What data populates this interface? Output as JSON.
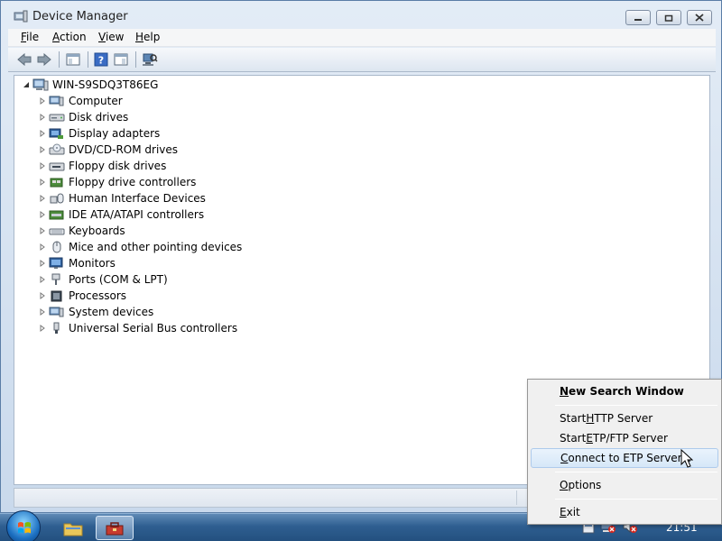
{
  "window": {
    "title": "Device Manager"
  },
  "menubar": {
    "items": [
      {
        "accel": "F",
        "rest": "ile"
      },
      {
        "accel": "A",
        "rest": "ction"
      },
      {
        "accel": "V",
        "rest": "iew"
      },
      {
        "accel": "H",
        "rest": "elp"
      }
    ]
  },
  "toolbar": {
    "buttons": [
      "back-icon",
      "forward-icon",
      "show-hide-console-tree-icon",
      "help-icon",
      "action-pane-icon",
      "scan-hardware-icon"
    ]
  },
  "tree": {
    "root": "WIN-S9SDQ3T86EG",
    "categories": [
      {
        "label": "Computer",
        "icon": "computer-icon"
      },
      {
        "label": "Disk drives",
        "icon": "disk-drive-icon"
      },
      {
        "label": "Display adapters",
        "icon": "display-adapter-icon"
      },
      {
        "label": "DVD/CD-ROM drives",
        "icon": "dvd-drive-icon"
      },
      {
        "label": "Floppy disk drives",
        "icon": "floppy-disk-icon"
      },
      {
        "label": "Floppy drive controllers",
        "icon": "floppy-controller-icon"
      },
      {
        "label": "Human Interface Devices",
        "icon": "hid-icon"
      },
      {
        "label": "IDE ATA/ATAPI controllers",
        "icon": "ide-controller-icon"
      },
      {
        "label": "Keyboards",
        "icon": "keyboard-icon"
      },
      {
        "label": "Mice and other pointing devices",
        "icon": "mouse-icon"
      },
      {
        "label": "Monitors",
        "icon": "monitor-icon"
      },
      {
        "label": "Ports (COM & LPT)",
        "icon": "port-icon"
      },
      {
        "label": "Processors",
        "icon": "processor-icon"
      },
      {
        "label": "System devices",
        "icon": "system-device-icon"
      },
      {
        "label": "Universal Serial Bus controllers",
        "icon": "usb-icon"
      }
    ]
  },
  "context_menu": {
    "items": [
      {
        "pre": "",
        "accel": "N",
        "post": "ew Search Window"
      },
      {
        "pre": "Start ",
        "accel": "H",
        "post": "TTP Server"
      },
      {
        "pre": "Start ",
        "accel": "E",
        "post": "TP/FTP Server"
      },
      {
        "pre": "",
        "accel": "C",
        "post": "onnect to ETP Server..."
      },
      {
        "pre": "",
        "accel": "O",
        "post": "ptions"
      },
      {
        "pre": "",
        "accel": "E",
        "post": "xit"
      }
    ]
  },
  "taskbar": {
    "clock": "21:51"
  },
  "colors": {
    "accent": "#1d5c91",
    "menu_highlight": "#d6e7f8"
  }
}
